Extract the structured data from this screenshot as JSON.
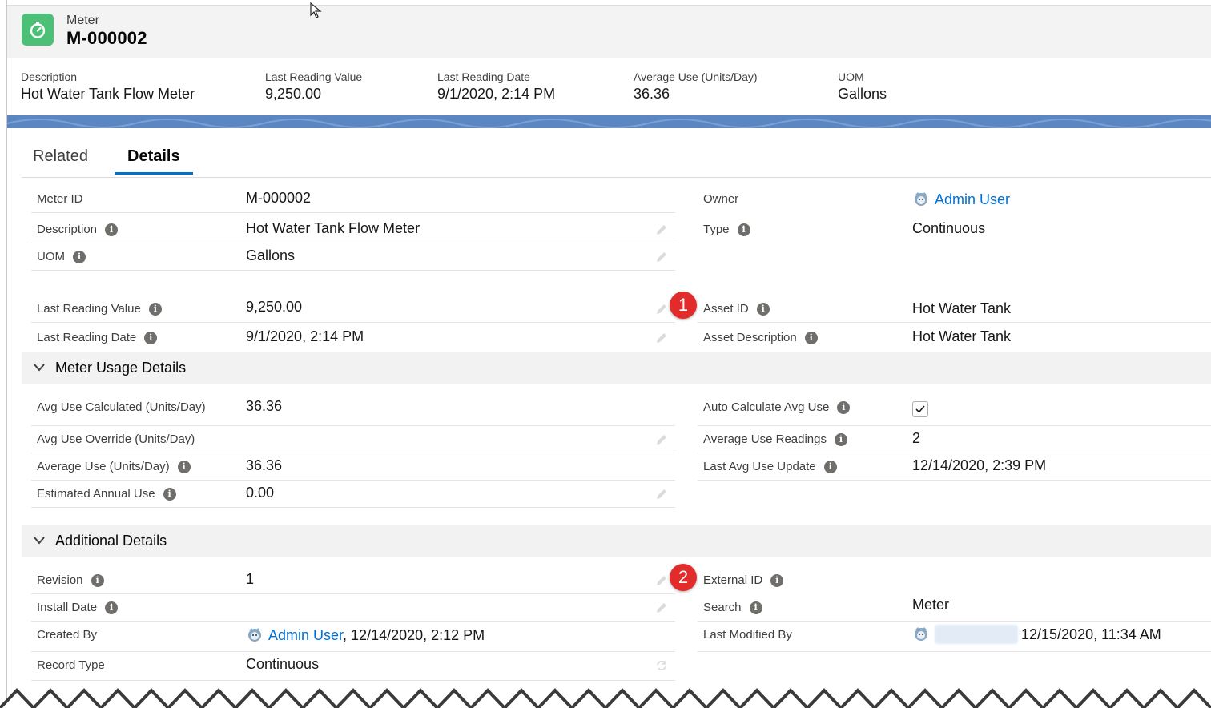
{
  "header": {
    "object_label": "Meter",
    "record_name": "M-000002",
    "icon": "meter-stopwatch-icon",
    "fields": [
      {
        "label": "Description",
        "value": "Hot Water Tank Flow Meter"
      },
      {
        "label": "Last Reading Value",
        "value": "9,250.00"
      },
      {
        "label": "Last Reading Date",
        "value": "9/1/2020, 2:14 PM"
      },
      {
        "label": "Average Use (Units/Day)",
        "value": "36.36"
      },
      {
        "label": "UOM",
        "value": "Gallons"
      }
    ]
  },
  "tabs": {
    "related": "Related",
    "details": "Details"
  },
  "details": {
    "meter_id": {
      "label": "Meter ID",
      "value": "M-000002"
    },
    "description": {
      "label": "Description",
      "value": "Hot Water Tank Flow Meter"
    },
    "uom": {
      "label": "UOM",
      "value": "Gallons"
    },
    "last_reading_value": {
      "label": "Last Reading Value",
      "value": "9,250.00"
    },
    "last_reading_date": {
      "label": "Last Reading Date",
      "value": "9/1/2020, 2:14 PM"
    },
    "owner": {
      "label": "Owner",
      "value": "Admin User"
    },
    "type": {
      "label": "Type",
      "value": "Continuous"
    },
    "asset_id": {
      "label": "Asset ID",
      "value": "Hot Water Tank"
    },
    "asset_description": {
      "label": "Asset Description",
      "value": "Hot Water Tank"
    }
  },
  "usage_section": {
    "title": "Meter Usage Details",
    "avg_use_calculated": {
      "label": "Avg Use Calculated (Units/Day)",
      "value": "36.36"
    },
    "avg_use_override": {
      "label": "Avg Use Override (Units/Day)",
      "value": ""
    },
    "average_use": {
      "label": "Average Use (Units/Day)",
      "value": "36.36"
    },
    "estimated_annual_use": {
      "label": "Estimated Annual Use",
      "value": "0.00"
    },
    "auto_calculate": {
      "label": "Auto Calculate Avg Use",
      "checked": true
    },
    "average_use_readings": {
      "label": "Average Use Readings",
      "value": "2"
    },
    "last_avg_use_update": {
      "label": "Last Avg Use Update",
      "value": "12/14/2020, 2:39 PM"
    }
  },
  "additional_section": {
    "title": "Additional Details",
    "revision": {
      "label": "Revision",
      "value": "1"
    },
    "install_date": {
      "label": "Install Date",
      "value": ""
    },
    "created_by": {
      "label": "Created By",
      "user": "Admin User",
      "date": ", 12/14/2020, 2:12 PM"
    },
    "record_type": {
      "label": "Record Type",
      "value": "Continuous"
    },
    "external_id": {
      "label": "External ID",
      "value": ""
    },
    "search": {
      "label": "Search",
      "value": "Meter"
    },
    "last_modified_by": {
      "label": "Last Modified By",
      "date": "12/15/2020, 11:34 AM"
    }
  },
  "callouts": [
    "1",
    "2"
  ],
  "colors": {
    "brand": "#0070d2",
    "meter_icon": "#4bc076",
    "callout": "#e22b2b",
    "banner": "#5a86c1"
  }
}
